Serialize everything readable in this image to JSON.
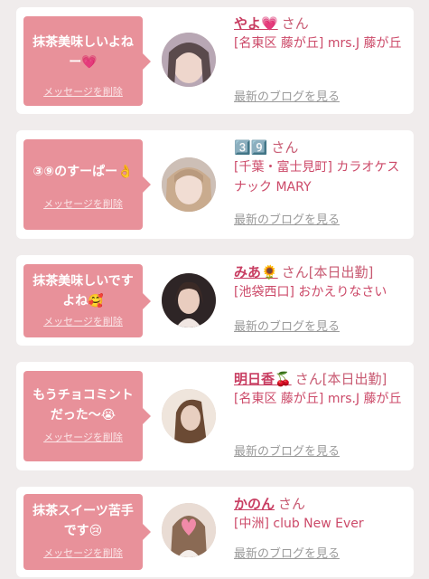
{
  "messages": [
    {
      "message": "抹茶美味しいよねー💗",
      "delete_label": "メッセージを削除",
      "name": "やよ💗",
      "honorific": "さん",
      "shop": "[名東区 藤が丘] mrs.J 藤が丘",
      "blog_label": "最新のブログを見る"
    },
    {
      "message": "③⑨のすーぱー👌",
      "delete_label": "メッセージを削除",
      "name": "3️⃣9️⃣",
      "honorific": "さん",
      "shop": "[千葉・富士見町] カラオケスナック MARY",
      "blog_label": "最新のブログを見る"
    },
    {
      "message": "抹茶美味しいですよね🥰",
      "delete_label": "メッセージを削除",
      "name": "みあ🌻",
      "honorific": "さん[本日出勤]",
      "shop": "[池袋西口] おかえりなさい",
      "blog_label": "最新のブログを見る"
    },
    {
      "message": "もうチョコミントだった〜😭",
      "delete_label": "メッセージを削除",
      "name": "明日香🍒",
      "honorific": "さん[本日出勤]",
      "shop": "[名東区 藤が丘] mrs.J 藤が丘",
      "blog_label": "最新のブログを見る"
    },
    {
      "message": "抹茶スイーツ苦手です😢",
      "delete_label": "メッセージを削除",
      "name": "かのん",
      "honorific": "さん",
      "shop": "[中洲] club New Ever",
      "blog_label": "最新のブログを見る"
    }
  ],
  "colors": {
    "page_background": "#f0ecec",
    "bubble": "#e8919a",
    "name_link": "#c83e62",
    "shop_text": "#cc4a69",
    "blog_link": "#9a9a9a"
  }
}
